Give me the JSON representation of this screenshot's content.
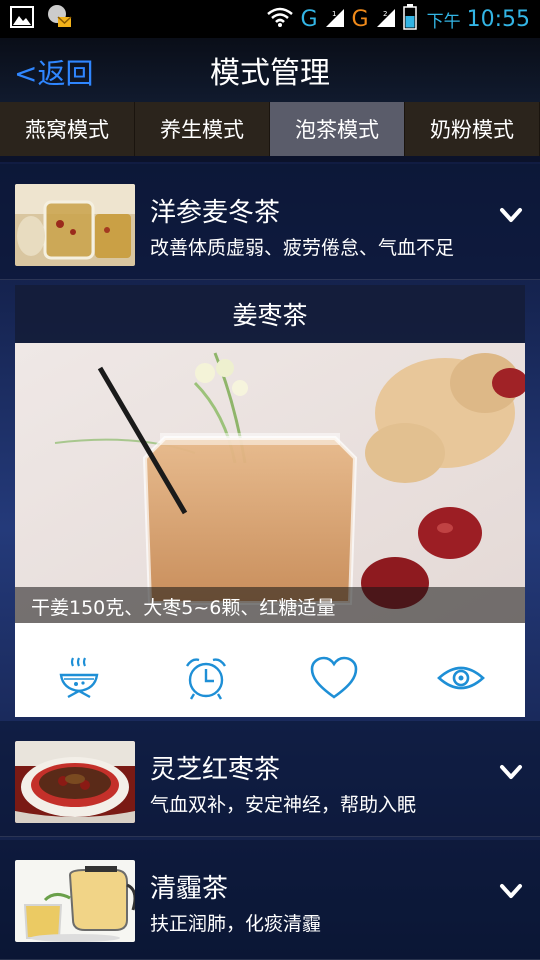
{
  "status_bar": {
    "net1": "G",
    "net2": "G",
    "ampm": "下午",
    "time": "10:55"
  },
  "header": {
    "back_label": "<返回",
    "title": "模式管理"
  },
  "tabs": [
    {
      "label": "燕窝模式",
      "active": false
    },
    {
      "label": "养生模式",
      "active": false
    },
    {
      "label": "泡茶模式",
      "active": true
    },
    {
      "label": "奶粉模式",
      "active": false
    }
  ],
  "items": [
    {
      "name": "洋参麦冬茶",
      "desc": "改善体质虚弱、疲劳倦怠、气血不足"
    },
    {
      "name": "灵芝红枣茶",
      "desc": "气血双补，安定神经，帮助入眠"
    },
    {
      "name": "清霾茶",
      "desc": "扶正润肺，化痰清霾"
    }
  ],
  "expanded": {
    "title": "姜枣茶",
    "caption": "干姜150克、大枣5~6颗、红糖适量",
    "actions": [
      "steam-bowl-icon",
      "alarm-clock-icon",
      "heart-icon",
      "eye-icon"
    ]
  },
  "colors": {
    "accent": "#2f86ff",
    "icon_blue": "#1e8fd6"
  }
}
